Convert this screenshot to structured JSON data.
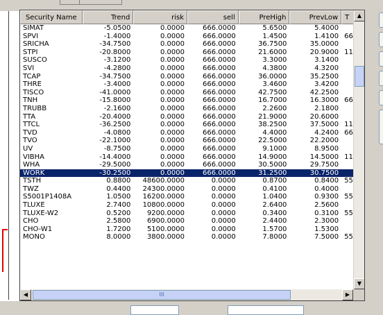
{
  "columns": [
    "Security Name",
    "Trend",
    "risk",
    "sell",
    "PreHigh",
    "PrevLow",
    "T"
  ],
  "rows": [
    [
      "SIMAT",
      "-5.0500",
      "0.0000",
      "666.0000",
      "5.6500",
      "5.4000",
      ""
    ],
    [
      "SPVI",
      "-1.4000",
      "0.0000",
      "666.0000",
      "1.4500",
      "1.4100",
      "66"
    ],
    [
      "SRICHA",
      "-34.7500",
      "0.0000",
      "666.0000",
      "36.7500",
      "35.0000",
      ""
    ],
    [
      "STPI",
      "-20.8000",
      "0.0000",
      "666.0000",
      "21.6000",
      "20.9000",
      "11"
    ],
    [
      "SUSCO",
      "-3.1200",
      "0.0000",
      "666.0000",
      "3.3000",
      "3.1400",
      ""
    ],
    [
      "SVI",
      "-4.2800",
      "0.0000",
      "666.0000",
      "4.3800",
      "4.3200",
      ""
    ],
    [
      "TCAP",
      "-34.7500",
      "0.0000",
      "666.0000",
      "36.0000",
      "35.2500",
      ""
    ],
    [
      "THRE",
      "-3.4000",
      "0.0000",
      "666.0000",
      "3.4600",
      "3.4200",
      ""
    ],
    [
      "TISCO",
      "-41.0000",
      "0.0000",
      "666.0000",
      "42.7500",
      "42.2500",
      ""
    ],
    [
      "TNH",
      "-15.8000",
      "0.0000",
      "666.0000",
      "16.7000",
      "16.3000",
      "66"
    ],
    [
      "TRUBB",
      "-2.1600",
      "0.0000",
      "666.0000",
      "2.2600",
      "2.1800",
      ""
    ],
    [
      "TTA",
      "-20.4000",
      "0.0000",
      "666.0000",
      "21.9000",
      "20.6000",
      ""
    ],
    [
      "TTCL",
      "-36.2500",
      "0.0000",
      "666.0000",
      "38.2500",
      "37.5000",
      "11"
    ],
    [
      "TVD",
      "-4.0800",
      "0.0000",
      "666.0000",
      "4.4000",
      "4.2400",
      "66"
    ],
    [
      "TVO",
      "-22.1000",
      "0.0000",
      "666.0000",
      "22.5000",
      "22.2000",
      ""
    ],
    [
      "UV",
      "-8.7500",
      "0.0000",
      "666.0000",
      "9.1000",
      "8.9500",
      ""
    ],
    [
      "VIBHA",
      "-14.4000",
      "0.0000",
      "666.0000",
      "14.9000",
      "14.5000",
      "11"
    ],
    [
      "WHA",
      "-29.5000",
      "0.0000",
      "666.0000",
      "30.5000",
      "29.7500",
      ""
    ],
    [
      "WORK",
      "-30.2500",
      "0.0000",
      "666.0000",
      "31.2500",
      "30.7500",
      ""
    ],
    [
      "TSTH",
      "0.8800",
      "48600.0000",
      "0.0000",
      "0.8700",
      "0.8400",
      "55"
    ],
    [
      "TWZ",
      "0.4400",
      "24300.0000",
      "0.0000",
      "0.4100",
      "0.4000",
      ""
    ],
    [
      "S5001P1408A",
      "1.0500",
      "16200.0000",
      "0.0000",
      "1.0400",
      "0.9300",
      "55"
    ],
    [
      "TLUXE",
      "2.7400",
      "10800.0000",
      "0.0000",
      "2.6400",
      "2.5600",
      ""
    ],
    [
      "TLUXE-W2",
      "0.5200",
      "9200.0000",
      "0.0000",
      "0.3400",
      "0.3100",
      "55"
    ],
    [
      "CHO",
      "2.5800",
      "6900.0000",
      "0.0000",
      "2.4400",
      "2.3000",
      ""
    ],
    [
      "CHO-W1",
      "1.7200",
      "5100.0000",
      "0.0000",
      "1.5700",
      "1.5300",
      ""
    ],
    [
      "MONO",
      "8.0000",
      "3800.0000",
      "0.0000",
      "7.8000",
      "7.5000",
      "55"
    ]
  ],
  "selected_row": 18,
  "colors": {
    "selection_bg": "#0a246a",
    "selection_fg": "#ffffff",
    "panel_bg": "#d4d0c8"
  },
  "scrollbar": {
    "hscroll_grip": "III"
  },
  "icons": {
    "scroll_up": "scroll-up-arrow-icon",
    "scroll_down": "scroll-down-arrow-icon",
    "scroll_left": "scroll-left-arrow-icon",
    "scroll_right": "scroll-right-arrow-icon"
  }
}
